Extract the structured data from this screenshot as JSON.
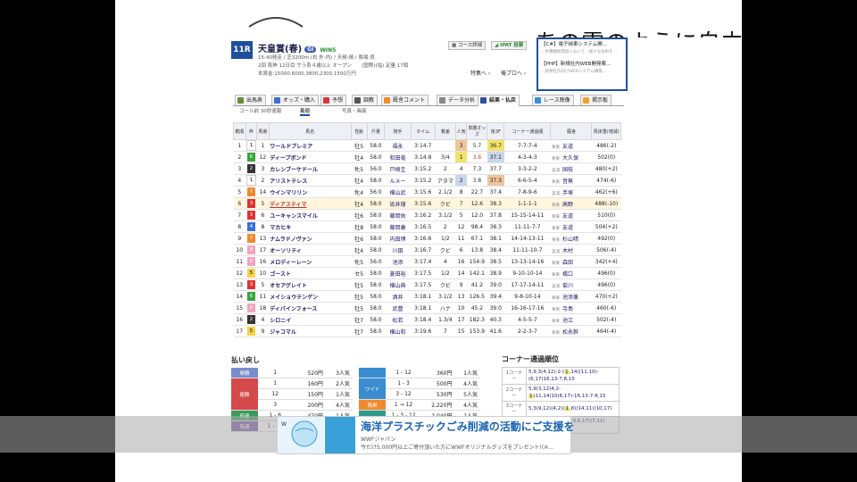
{
  "background": {
    "title_text": "あの雲のように自由に"
  },
  "header": {
    "race_no": "11R",
    "race_name": "天皇賞(春)",
    "grade": "GI",
    "win5": "WIN5",
    "line1": "15:40発走 / 芝3200m (右 外-内) / 天候:晴 / 馬場:良",
    "line2": "2回 阪神 12日目 サラ系４歳以上 オープン　　(国際)(指) 定量 17頭",
    "line3": "本賞金:15000,6000,3800,2300,1500万円"
  },
  "header_buttons": {
    "course": "コース詳細",
    "ipat": "IPAT 投票",
    "tokushu": "特集へ",
    "yoso": "俺プロへ"
  },
  "right_ad": {
    "line1": "【C#】電子納車システム開…",
    "line1_sub": "…各種機能開発において、様々な技術を…",
    "line2": "【PHP】新規社内WEB開発案…",
    "line2_sub": "…新規社内向けWEBシステム構築…"
  },
  "tabs": [
    {
      "label": "出馬表",
      "color": "#6a8b3a"
    },
    {
      "label": "オッズ・購入",
      "color": "#3a6fd8"
    },
    {
      "label": "予想",
      "color": "#d33"
    },
    {
      "label": "調教",
      "color": "#555"
    },
    {
      "label": "厩舎コメント",
      "color": "#f08a2c"
    },
    {
      "label": "データ分析",
      "color": "#888"
    },
    {
      "label": "結果・払戻",
      "color": "#2a4fa0"
    },
    {
      "label": "レース映像",
      "color": "#3a8dd0"
    },
    {
      "label": "掲示板",
      "color": "#f0a030"
    }
  ],
  "subtabs": [
    "ゴール前 30秒速報",
    "着順",
    "写真・画面"
  ],
  "table_headers": [
    "着順",
    "枠",
    "馬番",
    "馬名",
    "性齢",
    "斤量",
    "騎手",
    "タイム",
    "着差",
    "人気",
    "単勝オッズ",
    "後3F",
    "コーナー通過順",
    "厩舎",
    "馬体重(増減)"
  ],
  "results": [
    {
      "rank": "1",
      "waku": "1",
      "num": "1",
      "name": "ワールドプレミア",
      "sex": "牡5",
      "kin": "58.0",
      "jock": "福永",
      "time": "3:14.7",
      "diff": "",
      "pop": "3",
      "odds": "5.7",
      "last3f": "36.7",
      "corner": "7-7-7-4",
      "tag": "栗東",
      "trainer": "友道",
      "weight": "486(-2)"
    },
    {
      "rank": "2",
      "waku": "6",
      "num": "12",
      "name": "ディープボンド",
      "sex": "牡4",
      "kin": "58.0",
      "jock": "和田竜",
      "time": "3:14.8",
      "diff": "3/4",
      "pop": "1",
      "odds": "3.6",
      "last3f": "37.1",
      "corner": "4-3-4-3",
      "tag": "栗東",
      "trainer": "大久保",
      "weight": "502(0)"
    },
    {
      "rank": "3",
      "waku": "2",
      "num": "3",
      "name": "カレンブーケドール",
      "sex": "牝5",
      "kin": "56.0",
      "jock": "戸崎圭",
      "time": "3:15.2",
      "diff": "2",
      "pop": "4",
      "odds": "7.3",
      "last3f": "37.7",
      "corner": "3-3-2-2",
      "tag": "美浦",
      "trainer": "国枝",
      "weight": "480(+2)"
    },
    {
      "rank": "4",
      "waku": "1",
      "num": "2",
      "name": "アリストテレス",
      "sex": "牡4",
      "kin": "58.0",
      "jock": "ルメー",
      "time": "3:15.2",
      "diff": "アタマ",
      "pop": "2",
      "odds": "3.8",
      "last3f": "37.3",
      "corner": "6-6-5-4",
      "tag": "栗東",
      "trainer": "音無",
      "weight": "474(-6)"
    },
    {
      "rank": "5",
      "waku": "7",
      "num": "14",
      "name": "ウインマリリン",
      "sex": "牝4",
      "kin": "56.0",
      "jock": "横山武",
      "time": "3:15.6",
      "diff": "2.1/2",
      "pop": "8",
      "odds": "22.7",
      "last3f": "37.4",
      "corner": "7-8-9-6",
      "tag": "美浦",
      "trainer": "手塚",
      "weight": "462(+6)"
    },
    {
      "rank": "6",
      "waku": "3",
      "num": "5",
      "name": "ディアスティマ",
      "sex": "牡4",
      "kin": "58.0",
      "jock": "坂井瑠",
      "time": "3:15.6",
      "diff": "クビ",
      "pop": "7",
      "odds": "12.6",
      "last3f": "38.3",
      "corner": "1-1-1-1",
      "tag": "栗東",
      "trainer": "高野",
      "weight": "488(-10)"
    },
    {
      "rank": "7",
      "waku": "3",
      "num": "6",
      "name": "ユーキャンスマイル",
      "sex": "牡6",
      "kin": "58.0",
      "jock": "藤岡佑",
      "time": "3:16.2",
      "diff": "3.1/2",
      "pop": "5",
      "odds": "12.0",
      "last3f": "37.8",
      "corner": "15-15-14-11",
      "tag": "栗東",
      "trainer": "友道",
      "weight": "510(0)"
    },
    {
      "rank": "8",
      "waku": "4",
      "num": "8",
      "name": "マカヒキ",
      "sex": "牡8",
      "kin": "58.0",
      "jock": "藤岡康",
      "time": "3:16.5",
      "diff": "2",
      "pop": "12",
      "odds": "98.4",
      "last3f": "38.3",
      "corner": "11-11-7-7",
      "tag": "栗東",
      "trainer": "友道",
      "weight": "504(+2)"
    },
    {
      "rank": "9",
      "waku": "7",
      "num": "13",
      "name": "ナムラドノヴァン",
      "sex": "牡6",
      "kin": "58.0",
      "jock": "内田博",
      "time": "3:16.6",
      "diff": "1/2",
      "pop": "11",
      "odds": "67.1",
      "last3f": "38.1",
      "corner": "14-14-13-11",
      "tag": "栗東",
      "trainer": "杉山晴",
      "weight": "492(0)"
    },
    {
      "rank": "10",
      "waku": "8",
      "num": "17",
      "name": "オーソリティ",
      "sex": "牡4",
      "kin": "58.0",
      "jock": "川田",
      "time": "3:16.7",
      "diff": "クビ",
      "pop": "6",
      "odds": "13.8",
      "last3f": "38.4",
      "corner": "11-11-10-7",
      "tag": "美浦",
      "trainer": "木村",
      "weight": "506(-4)"
    },
    {
      "rank": "11",
      "waku": "8",
      "num": "16",
      "name": "メロディーレーン",
      "sex": "牝5",
      "kin": "56.0",
      "jock": "池添",
      "time": "3:17.4",
      "diff": "4",
      "pop": "16",
      "odds": "154.9",
      "last3f": "38.5",
      "corner": "13-13-14-16",
      "tag": "栗東",
      "trainer": "森田",
      "weight": "342(+4)"
    },
    {
      "rank": "12",
      "waku": "5",
      "num": "10",
      "name": "ゴースト",
      "sex": "セ5",
      "kin": "58.0",
      "jock": "菱田裕",
      "time": "3:17.5",
      "diff": "1/2",
      "pop": "14",
      "odds": "142.1",
      "last3f": "38.9",
      "corner": "9-10-10-14",
      "tag": "栗東",
      "trainer": "橋口",
      "weight": "496(0)"
    },
    {
      "rank": "13",
      "waku": "3",
      "num": "5",
      "name": "オセアグレイト",
      "sex": "牡5",
      "kin": "58.0",
      "jock": "横山典",
      "time": "3:17.5",
      "diff": "クビ",
      "pop": "9",
      "odds": "41.2",
      "last3f": "39.0",
      "corner": "17-17-14-11",
      "tag": "美浦",
      "trainer": "菊川",
      "weight": "496(0)"
    },
    {
      "rank": "14",
      "waku": "6",
      "num": "11",
      "name": "メイショウテンゲン",
      "sex": "牡5",
      "kin": "58.0",
      "jock": "酒井",
      "time": "3:18.1",
      "diff": "3.1/2",
      "pop": "13",
      "odds": "126.5",
      "last3f": "39.4",
      "corner": "9-8-10-14",
      "tag": "栗東",
      "trainer": "池添兼",
      "weight": "470(+2)"
    },
    {
      "rank": "15",
      "waku": "8",
      "num": "18",
      "name": "ディバインフォース",
      "sex": "牡5",
      "kin": "58.0",
      "jock": "武豊",
      "time": "3:18.1",
      "diff": "ハナ",
      "pop": "10",
      "odds": "45.2",
      "last3f": "39.0",
      "corner": "16-16-17-16",
      "tag": "栗東",
      "trainer": "寺島",
      "weight": "460(-6)"
    },
    {
      "rank": "16",
      "waku": "2",
      "num": "4",
      "name": "シロニイ",
      "sex": "牡7",
      "kin": "58.0",
      "jock": "松若",
      "time": "3:18.4",
      "diff": "1.3/4",
      "pop": "17",
      "odds": "182.3",
      "last3f": "40.3",
      "corner": "4-5-5-7",
      "tag": "栗東",
      "trainer": "池江",
      "weight": "502(-4)"
    },
    {
      "rank": "17",
      "waku": "5",
      "num": "9",
      "name": "ジャコマル",
      "sex": "牡7",
      "kin": "58.0",
      "jock": "横山和",
      "time": "3:19.6",
      "diff": "7",
      "pop": "15",
      "odds": "153.9",
      "last3f": "41.6",
      "corner": "2-2-3-7",
      "tag": "栗東",
      "trainer": "松永幹",
      "weight": "464(-4)"
    }
  ],
  "payout": {
    "title": "払い戻し",
    "left": [
      {
        "label": "単勝",
        "cls": "c-tan",
        "rows": [
          {
            "num": "1",
            "yen": "520円",
            "ninki": "3人気"
          }
        ]
      },
      {
        "label": "複勝",
        "cls": "c-fuku",
        "rows": [
          {
            "num": "1",
            "yen": "160円",
            "ninki": "2人気"
          },
          {
            "num": "12",
            "yen": "150円",
            "ninki": "1人気"
          },
          {
            "num": "3",
            "yen": "200円",
            "ninki": "4人気"
          }
        ]
      },
      {
        "label": "枠連",
        "cls": "c-waku",
        "rows": [
          {
            "num": "1 - 6",
            "yen": "470円",
            "ninki": "1人気"
          }
        ]
      },
      {
        "label": "馬連",
        "cls": "c-uren",
        "rows": [
          {
            "num": "1 - 12",
            "yen": "",
            "ninki": ""
          }
        ]
      }
    ],
    "right": [
      {
        "label": "",
        "cls": "",
        "rows": [
          {
            "num": "1 - 12",
            "yen": "360円",
            "ninki": "1人気"
          }
        ]
      },
      {
        "label": "ワイド",
        "cls": "c-wide",
        "rows": [
          {
            "num": "1 - 3",
            "yen": "500円",
            "ninki": "4人気"
          },
          {
            "num": "3 - 12",
            "yen": "530円",
            "ninki": "5人気"
          }
        ]
      },
      {
        "label": "馬単",
        "cls": "c-utan",
        "rows": [
          {
            "num": "1 → 12",
            "yen": "2,220円",
            "ninki": "4人気"
          }
        ]
      },
      {
        "label": "",
        "cls": "",
        "rows": [
          {
            "num": "1 - 3 - 12",
            "yen": "2,040円",
            "ninki": "2人気"
          }
        ]
      }
    ]
  },
  "corner_order": {
    "title": "コーナー通過順位",
    "rows": [
      {
        "label": "1コーナー",
        "pre": "5,9,3(4,12)-2-(",
        "hl": "1",
        "post": ",14)(11,10)-(6,17)16,13-7,8,15"
      },
      {
        "label": "2コーナー",
        "pre": "5,9(3,12)4,2-",
        "hl": "1",
        "post": "(11,14)10(6,17)-16,13-7-8,15"
      },
      {
        "label": "3コーナー",
        "pre": "5,3(9,12)(4,2)(",
        "hl": "1",
        "post": ",8)(14,11)(10,17)"
      },
      {
        "label": "4コーナー",
        "pre": "5(3,12)(",
        "hl": "1",
        "post": ",2)14(4,9,6,17)(7,11)(13,10)16,8"
      }
    ]
  },
  "bottom_ad": {
    "main": "海洋プラスチックごみ削減の活動にご支援を",
    "sub1": "WWFジャパン",
    "sub2": "今だけ5,000円以上ご寄付頂いた方にWWFオリジナルグッズをプレゼント!(※…"
  }
}
